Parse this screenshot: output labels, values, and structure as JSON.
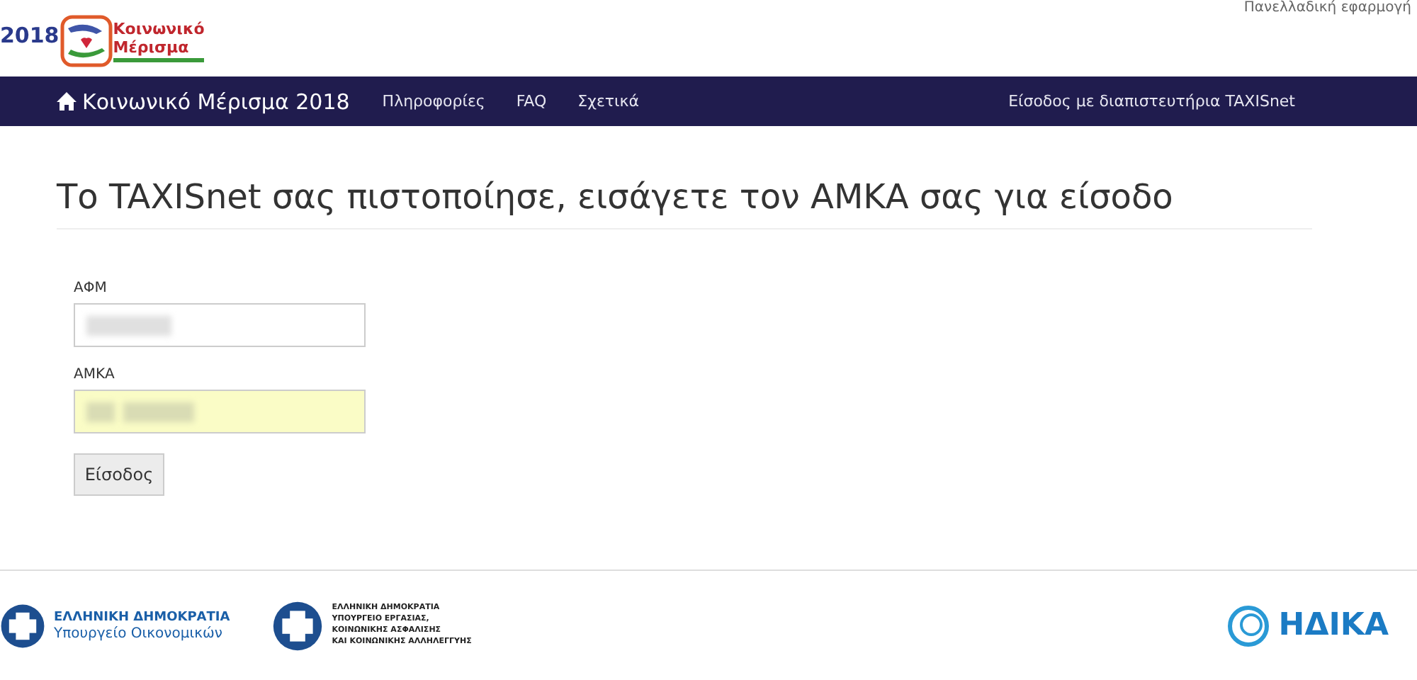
{
  "header": {
    "logo_year": "2018",
    "logo_text": [
      "Κοινωνικό",
      "Μέρισμα"
    ],
    "tagline": "Πανελλαδική εφαρμογή"
  },
  "navbar": {
    "brand": "Κοινωνικό Μέρισμα 2018",
    "links": [
      {
        "label": "Πληροφορίες"
      },
      {
        "label": "FAQ"
      },
      {
        "label": "Σχετικά"
      }
    ],
    "right_link": "Είσοδος με διαπιστευτήρια TAXISnet"
  },
  "heading": "Το TAXISnet σας πιστοποίησε, εισάγετε τον ΑΜΚΑ σας για είσοδο",
  "form": {
    "fields": [
      {
        "label": "ΑΦΜ",
        "autofilled": false
      },
      {
        "label": "ΑΜΚΑ",
        "autofilled": true
      }
    ],
    "submit": "Είσοδος"
  },
  "footer": {
    "logos": [
      {
        "kind": "ministry",
        "title": "ΕΛΛΗΝΙΚΗ ΔΗΜΟΚΡΑΤΙΑ",
        "subtitle": "Υπουργείο Οικονομικών"
      },
      {
        "kind": "ministry_small",
        "lines": [
          "ΕΛΛΗΝΙΚΗ ΔΗΜΟΚΡΑΤΙΑ",
          "ΥΠΟΥΡΓΕΙΟ ΕΡΓΑΣΙΑΣ,",
          "ΚΟΙΝΩΝΙΚΗΣ ΑΣΦΑΛΙΣΗΣ",
          "ΚΑΙ ΚΟΙΝΩΝΙΚΗΣ ΑΛΛΗΛΕΓΓΥΗΣ"
        ]
      },
      {
        "kind": "company",
        "title": "ΗΔΙΚΑ"
      }
    ]
  }
}
